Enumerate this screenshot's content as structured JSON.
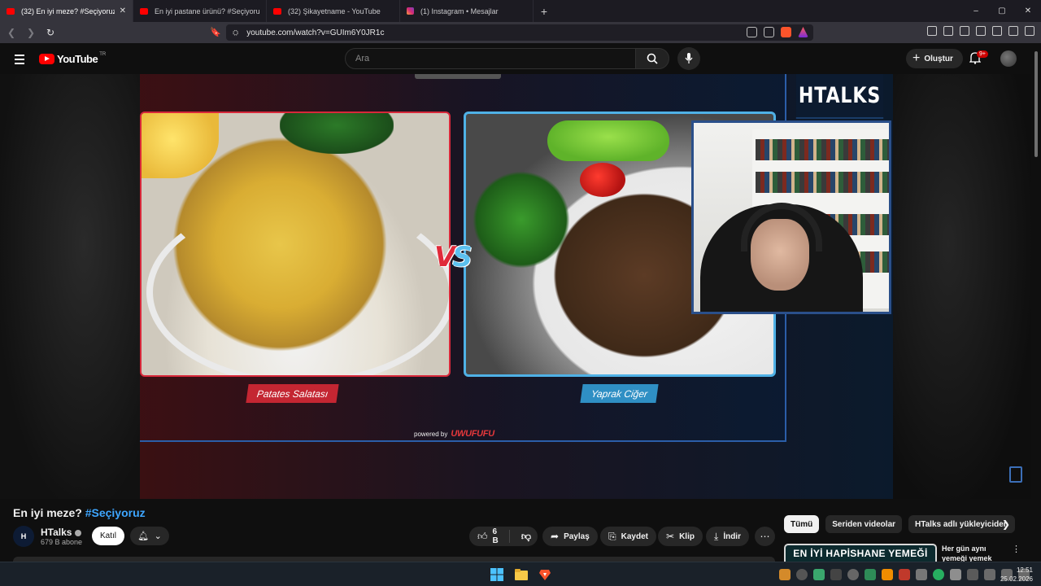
{
  "browser": {
    "tabs": [
      {
        "title": "(32) En iyi meze? #Seçiyoruz",
        "icon": "youtube-icon",
        "active": true
      },
      {
        "title": "En iyi pastane ürünü? #Seçiyoruz - Yo",
        "icon": "youtube-icon",
        "active": false
      },
      {
        "title": "(32) Şikayetname - YouTube",
        "icon": "youtube-icon",
        "active": false
      },
      {
        "title": "(1) Instagram • Mesajlar",
        "icon": "instagram-icon",
        "active": false
      }
    ],
    "new_tab": "+",
    "url": "youtube.com/watch?v=GUIm6Y0JR1c",
    "window_controls": {
      "minimize": "–",
      "maximize": "▢",
      "close": "✕"
    }
  },
  "youtube": {
    "logo_text": "YouTube",
    "region": "TR",
    "search_placeholder": "Ara",
    "create_label": "Oluştur",
    "notification_badge": "9+"
  },
  "video_frame": {
    "left_item": "Patates Salatası",
    "right_item": "Yaprak Ciğer",
    "vs_v": "V",
    "vs_s": "S",
    "powered_by": "powered by",
    "powered_brand": "UWUFUFU",
    "brand": "HTALKS"
  },
  "video": {
    "title": "En iyi meze?",
    "hashtag": "#Seçiyoruz",
    "channel": "HTalks",
    "channel_avatar_text": "H",
    "subscribers": "679 B abone",
    "join_label": "Katıl",
    "likes": "6 B",
    "share_label": "Paylaş",
    "save_label": "Kaydet",
    "clip_label": "Klip",
    "download_label": "İndir"
  },
  "sidebar": {
    "chips": [
      "Tümü",
      "Seriden videolar",
      "HTalks adlı yükleyiciden"
    ],
    "recommendation": {
      "thumb_text": "EN İYİ HAPİSHANE YEMEĞİ",
      "title": "Her gün aynı yemeği yemek"
    }
  },
  "taskbar": {
    "time": "12:51",
    "date": "25.02.2026"
  },
  "colors": {
    "youtube_red": "#ff0000",
    "hashtag_blue": "#3ea6ff",
    "left_accent": "#c42632",
    "right_accent": "#2f8fc4"
  }
}
